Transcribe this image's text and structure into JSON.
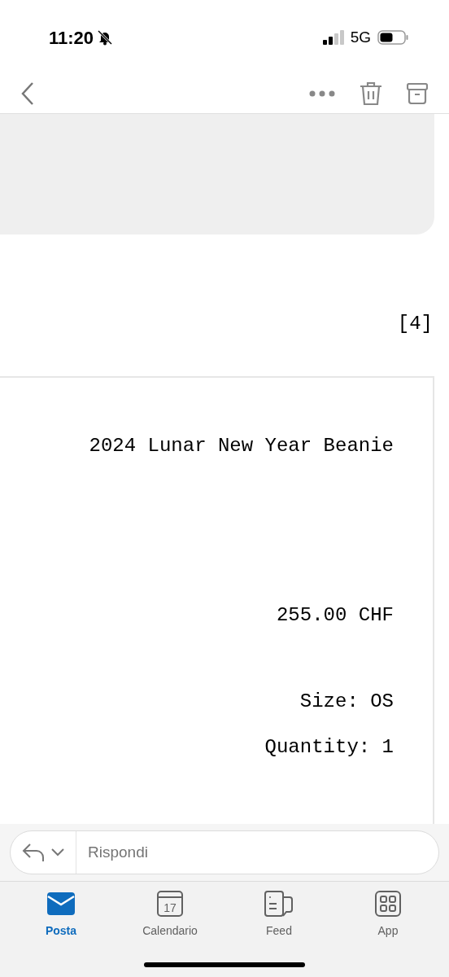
{
  "status_bar": {
    "time": "11:20",
    "silent": true,
    "network": "5G"
  },
  "reference": "[4]",
  "product": {
    "name": "2024 Lunar New Year Beanie",
    "price": "255.00 CHF",
    "size": "Size: OS",
    "quantity": "Quantity: 1"
  },
  "reply": {
    "placeholder": "Rispondi"
  },
  "tabs": [
    {
      "label": "Posta",
      "kind": "mail",
      "selected": true
    },
    {
      "label": "Calendario",
      "kind": "calendar",
      "icon_text": "17",
      "selected": false
    },
    {
      "label": "Feed",
      "kind": "feed",
      "selected": false
    },
    {
      "label": "App",
      "kind": "apps",
      "selected": false
    }
  ]
}
